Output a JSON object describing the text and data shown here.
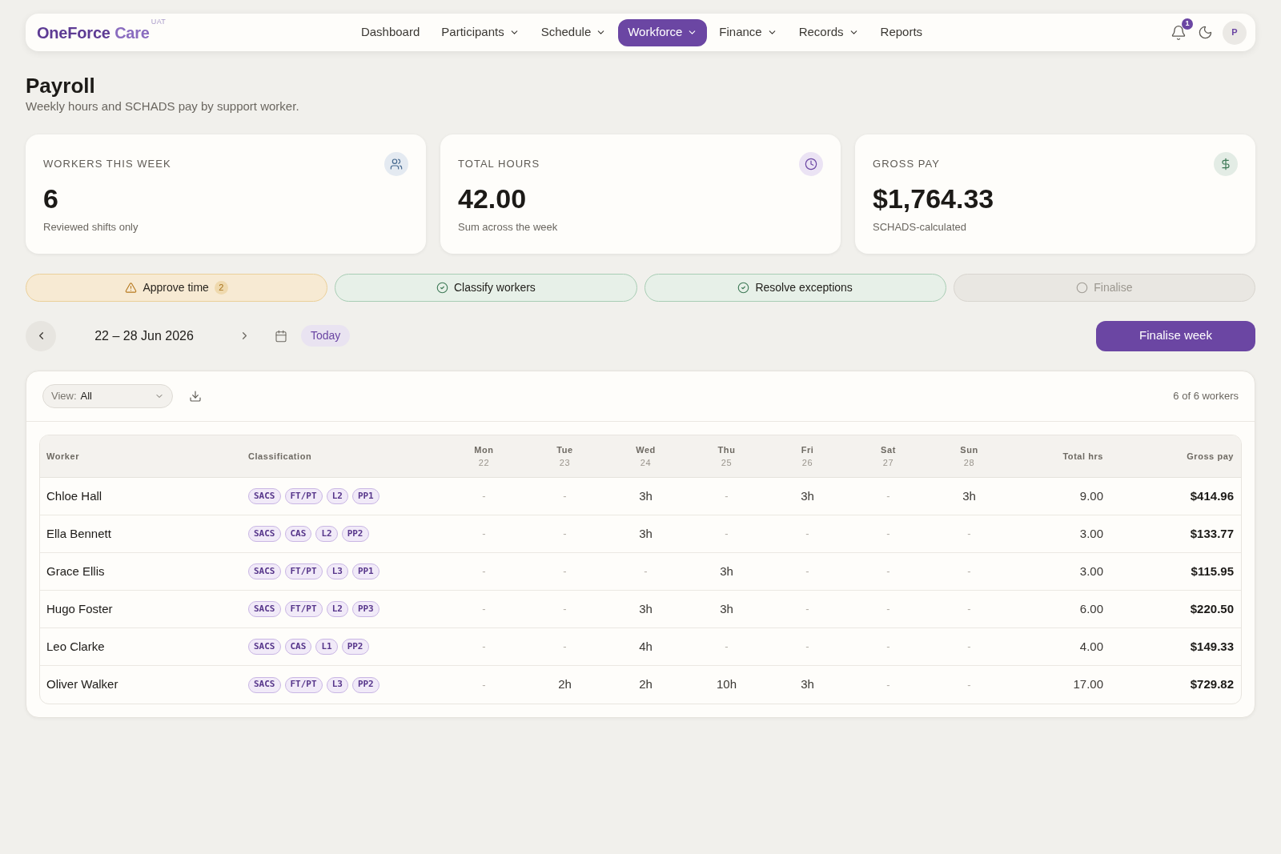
{
  "nav": {
    "logo": {
      "name": "OneForce",
      "suffix": "Care",
      "environment": "UAT"
    },
    "items": [
      {
        "label": "Dashboard",
        "has_menu": false,
        "selected": false
      },
      {
        "label": "Participants",
        "has_menu": true,
        "selected": false
      },
      {
        "label": "Schedule",
        "has_menu": true,
        "selected": false
      },
      {
        "label": "Workforce",
        "has_menu": true,
        "selected": true
      },
      {
        "label": "Finance",
        "has_menu": true,
        "selected": false
      },
      {
        "label": "Records",
        "has_menu": true,
        "selected": false
      },
      {
        "label": "Reports",
        "has_menu": false,
        "selected": false
      }
    ],
    "notifications": {
      "count": "1"
    },
    "avatar": "P"
  },
  "page": {
    "title": "Payroll",
    "subtitle": "Weekly hours and SCHADS pay by support worker."
  },
  "stats": [
    {
      "kind": "count",
      "label": "WORKERS THIS WEEK",
      "value": "6",
      "note": "Reviewed shifts only"
    },
    {
      "kind": "hours",
      "label": "TOTAL HOURS",
      "value": "42.00",
      "note": "Sum across the week"
    },
    {
      "kind": "money",
      "label": "GROSS PAY",
      "value": "$1,764.33",
      "note": "SCHADS-calculated"
    }
  ],
  "steps": [
    {
      "kind": "warning",
      "label": "Approve time",
      "count": "2"
    },
    {
      "kind": "done",
      "label": "Classify workers"
    },
    {
      "kind": "done",
      "label": "Resolve exceptions"
    },
    {
      "kind": "pending",
      "label": "Finalise"
    }
  ],
  "week": {
    "range": "22 – 28 Jun 2026",
    "today": "Today"
  },
  "primary_action": "Finalise week",
  "table": {
    "view": {
      "label": "View:",
      "value": "All"
    },
    "count": "6 of 6 workers",
    "columns": [
      {
        "kind": "text",
        "label": "Worker"
      },
      {
        "kind": "tags",
        "label": "Classification"
      },
      {
        "kind": "day",
        "label": "Mon",
        "date": "22"
      },
      {
        "kind": "day",
        "label": "Tue",
        "date": "23"
      },
      {
        "kind": "day",
        "label": "Wed",
        "date": "24"
      },
      {
        "kind": "day",
        "label": "Thu",
        "date": "25"
      },
      {
        "kind": "day",
        "label": "Fri",
        "date": "26"
      },
      {
        "kind": "day",
        "label": "Sat",
        "date": "27"
      },
      {
        "kind": "day",
        "label": "Sun",
        "date": "28"
      },
      {
        "kind": "hours",
        "label": "Total hrs"
      },
      {
        "kind": "money",
        "label": "Gross pay"
      }
    ],
    "rows": [
      {
        "worker": "Chloe Hall",
        "tags": [
          "SACS",
          "FT/PT",
          "L2",
          "PP1"
        ],
        "days": [
          {
            "text": "-",
            "empty": true
          },
          {
            "text": "-",
            "empty": true
          },
          {
            "text": "3h",
            "empty": false
          },
          {
            "text": "-",
            "empty": true
          },
          {
            "text": "3h",
            "empty": false
          },
          {
            "text": "-",
            "empty": true
          },
          {
            "text": "3h",
            "empty": false
          }
        ],
        "total_hrs": "9.00",
        "gross_pay": "$414.96"
      },
      {
        "worker": "Ella Bennett",
        "tags": [
          "SACS",
          "CAS",
          "L2",
          "PP2"
        ],
        "days": [
          {
            "text": "-",
            "empty": true
          },
          {
            "text": "-",
            "empty": true
          },
          {
            "text": "3h",
            "empty": false
          },
          {
            "text": "-",
            "empty": true
          },
          {
            "text": "-",
            "empty": true
          },
          {
            "text": "-",
            "empty": true
          },
          {
            "text": "-",
            "empty": true
          }
        ],
        "total_hrs": "3.00",
        "gross_pay": "$133.77"
      },
      {
        "worker": "Grace Ellis",
        "tags": [
          "SACS",
          "FT/PT",
          "L3",
          "PP1"
        ],
        "days": [
          {
            "text": "-",
            "empty": true
          },
          {
            "text": "-",
            "empty": true
          },
          {
            "text": "-",
            "empty": true
          },
          {
            "text": "3h",
            "empty": false
          },
          {
            "text": "-",
            "empty": true
          },
          {
            "text": "-",
            "empty": true
          },
          {
            "text": "-",
            "empty": true
          }
        ],
        "total_hrs": "3.00",
        "gross_pay": "$115.95"
      },
      {
        "worker": "Hugo Foster",
        "tags": [
          "SACS",
          "FT/PT",
          "L2",
          "PP3"
        ],
        "days": [
          {
            "text": "-",
            "empty": true
          },
          {
            "text": "-",
            "empty": true
          },
          {
            "text": "3h",
            "empty": false
          },
          {
            "text": "3h",
            "empty": false
          },
          {
            "text": "-",
            "empty": true
          },
          {
            "text": "-",
            "empty": true
          },
          {
            "text": "-",
            "empty": true
          }
        ],
        "total_hrs": "6.00",
        "gross_pay": "$220.50"
      },
      {
        "worker": "Leo Clarke",
        "tags": [
          "SACS",
          "CAS",
          "L1",
          "PP2"
        ],
        "days": [
          {
            "text": "-",
            "empty": true
          },
          {
            "text": "-",
            "empty": true
          },
          {
            "text": "4h",
            "empty": false
          },
          {
            "text": "-",
            "empty": true
          },
          {
            "text": "-",
            "empty": true
          },
          {
            "text": "-",
            "empty": true
          },
          {
            "text": "-",
            "empty": true
          }
        ],
        "total_hrs": "4.00",
        "gross_pay": "$149.33"
      },
      {
        "worker": "Oliver Walker",
        "tags": [
          "SACS",
          "FT/PT",
          "L3",
          "PP2"
        ],
        "days": [
          {
            "text": "-",
            "empty": true
          },
          {
            "text": "2h",
            "empty": false
          },
          {
            "text": "2h",
            "empty": false
          },
          {
            "text": "10h",
            "empty": false
          },
          {
            "text": "3h",
            "empty": false
          },
          {
            "text": "-",
            "empty": true
          },
          {
            "text": "-",
            "empty": true
          }
        ],
        "total_hrs": "17.00",
        "gross_pay": "$729.82"
      }
    ]
  }
}
